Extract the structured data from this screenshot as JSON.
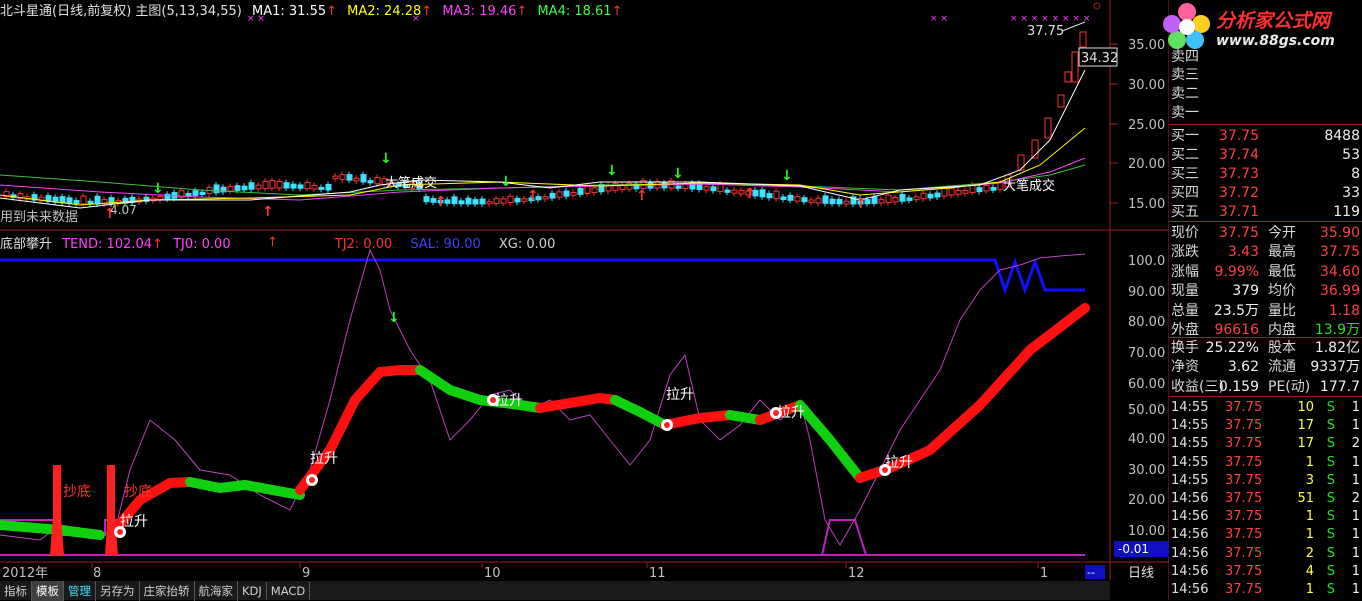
{
  "header": {
    "title": "北斗星通(日线,前复权) 主图(5,13,34,55)",
    "ma1": "MA1: 31.55",
    "ma2": "MA2: 24.28",
    "ma3": "MA3: 19.46",
    "ma4": "MA4: 18.61",
    "arrow": "↑"
  },
  "indicator": {
    "name": "底部攀升",
    "tend": "TEND: 102.04",
    "tj0": "TJ0: 0.00",
    "tj2": "TJ2: 0.00",
    "sal": "SAL: 90.00",
    "xg": "XG: 0.00",
    "arrow": "↑"
  },
  "main_chart": {
    "price_ticks": [
      "35.00",
      "30.00",
      "25.00",
      "20.00",
      "15.00"
    ],
    "high_label": "37.75",
    "last_label": "34.32",
    "low_label": "4.07",
    "notes": [
      "用到未来数据",
      "大笔成交",
      "大笔成交"
    ]
  },
  "sub_chart": {
    "ticks": [
      "100.0",
      "90.00",
      "80.00",
      "70.00",
      "60.00",
      "50.00",
      "40.00",
      "30.00",
      "20.00",
      "10.00"
    ],
    "current_value": "-0.01",
    "labels": [
      "抄底",
      "抄底",
      "拉升",
      "拉升",
      "拉升",
      "拉升",
      "拉升",
      "拉升"
    ]
  },
  "x_axis": {
    "labels": [
      "2012年",
      "8",
      "9",
      "10",
      "11",
      "12",
      "1"
    ],
    "period": "日线",
    "end_marker": "--"
  },
  "tabs": [
    "指标",
    "模板",
    "管理",
    "另存为",
    "庄家抬轿",
    "航海家",
    "KDJ",
    "MACD"
  ],
  "logo": {
    "title": "分析家公式网",
    "url": "www.88gs.com"
  },
  "quote": {
    "sell": [
      {
        "label": "卖四"
      },
      {
        "label": "卖三"
      },
      {
        "label": "卖二"
      },
      {
        "label": "卖一"
      }
    ],
    "buy": [
      {
        "label": "买一",
        "price": "37.75",
        "vol": "8488"
      },
      {
        "label": "买二",
        "price": "37.74",
        "vol": "53"
      },
      {
        "label": "买三",
        "price": "37.73",
        "vol": "8"
      },
      {
        "label": "买四",
        "price": "37.72",
        "vol": "33"
      },
      {
        "label": "买五",
        "price": "37.71",
        "vol": "119"
      }
    ],
    "stats": [
      {
        "l1": "现价",
        "v1": "37.75",
        "c1": "red",
        "l2": "今开",
        "v2": "35.90",
        "c2": "red"
      },
      {
        "l1": "涨跌",
        "v1": "3.43",
        "c1": "red",
        "l2": "最高",
        "v2": "37.75",
        "c2": "red"
      },
      {
        "l1": "涨幅",
        "v1": "9.99%",
        "c1": "red",
        "l2": "最低",
        "v2": "34.60",
        "c2": "red"
      },
      {
        "l1": "现量",
        "v1": "379",
        "c1": "white",
        "l2": "均价",
        "v2": "36.99",
        "c2": "red"
      },
      {
        "l1": "总量",
        "v1": "23.5万",
        "c1": "white",
        "l2": "量比",
        "v2": "1.18",
        "c2": "red"
      },
      {
        "l1": "外盘",
        "v1": "96616",
        "c1": "red",
        "l2": "内盘",
        "v2": "13.9万",
        "c2": "green"
      }
    ],
    "stats2": [
      {
        "l1": "换手",
        "v1": "25.22%",
        "c1": "white",
        "l2": "股本",
        "v2": "1.82亿",
        "c2": "white"
      },
      {
        "l1": "净资",
        "v1": "3.62",
        "c1": "white",
        "l2": "流通",
        "v2": "9337万",
        "c2": "white"
      },
      {
        "l1": "收益(三)",
        "v1": "0.159",
        "c1": "white",
        "l2": "PE(动)",
        "v2": "177.7",
        "c2": "white"
      }
    ],
    "ticks": [
      {
        "time": "14:55",
        "price": "37.75",
        "vol": "10",
        "side": "S",
        "n": "1"
      },
      {
        "time": "14:55",
        "price": "37.75",
        "vol": "17",
        "side": "S",
        "n": "1"
      },
      {
        "time": "14:55",
        "price": "37.75",
        "vol": "17",
        "side": "S",
        "n": "2"
      },
      {
        "time": "14:55",
        "price": "37.75",
        "vol": "1",
        "side": "S",
        "n": "1"
      },
      {
        "time": "14:55",
        "price": "37.75",
        "vol": "3",
        "side": "S",
        "n": "1"
      },
      {
        "time": "14:56",
        "price": "37.75",
        "vol": "51",
        "side": "S",
        "n": "2"
      },
      {
        "time": "14:56",
        "price": "37.75",
        "vol": "1",
        "side": "S",
        "n": "1"
      },
      {
        "time": "14:56",
        "price": "37.75",
        "vol": "1",
        "side": "S",
        "n": "1"
      },
      {
        "time": "14:56",
        "price": "37.75",
        "vol": "2",
        "side": "S",
        "n": "1"
      },
      {
        "time": "14:56",
        "price": "37.75",
        "vol": "4",
        "side": "S",
        "n": "1"
      },
      {
        "time": "14:56",
        "price": "37.75",
        "vol": "1",
        "side": "S",
        "n": "1"
      }
    ]
  },
  "colors": {
    "ma1": "#ffffff",
    "ma2": "#ffff00",
    "ma3": "#ff40ff",
    "ma4": "#40ff40",
    "up": "#ff3030",
    "down": "#20ff20",
    "blue_line": "#1010ff",
    "purple": "#c040c0"
  }
}
